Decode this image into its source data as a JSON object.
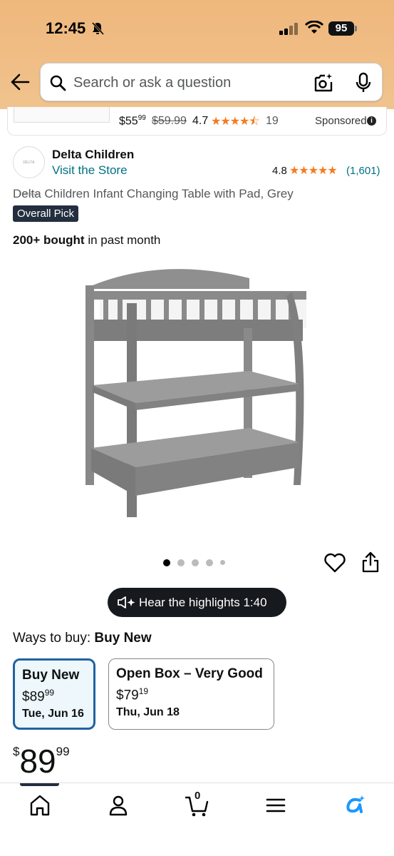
{
  "status_bar": {
    "time": "12:45",
    "battery": "95"
  },
  "search": {
    "placeholder": "Search or ask a question"
  },
  "sponsored": {
    "price_whole": "$55",
    "price_fraction": "99",
    "old_price": "$59.99",
    "rating": "4.7",
    "review_count": "19",
    "label": "Sponsored"
  },
  "brand": {
    "logo_text": "DELTA CHILDREN",
    "name": "Delta Children",
    "visit_store": "Visit the Store",
    "rating": "4.8",
    "rating_count": "(1,601)"
  },
  "product": {
    "title": "Delta Children Infant Changing Table with Pad, Grey",
    "badge": "Overall Pick",
    "bought_bold": "200+ bought",
    "bought_rest": " in past month",
    "image_count": 5,
    "active_image": 1
  },
  "hear_highlights": {
    "label": "Hear the highlights 1:40"
  },
  "ways_to_buy": {
    "label": "Ways to buy: ",
    "current": "Buy New",
    "options": [
      {
        "title": "Buy New",
        "price_whole": "$89",
        "price_fraction": "99",
        "date": "Tue, Jun 16",
        "selected": true
      },
      {
        "title": "Open Box – Very Good",
        "price_whole": "$79",
        "price_fraction": "19",
        "date": "Thu, Jun 18",
        "selected": false
      }
    ]
  },
  "price": {
    "currency": "$",
    "whole": "89",
    "fraction": "99"
  },
  "bottom_nav": {
    "cart_count": "0"
  },
  "colors": {
    "header": "#efb77c",
    "link": "#007185",
    "star": "#f47c20",
    "selected_border": "#2162a1",
    "dark": "#161a1e"
  }
}
